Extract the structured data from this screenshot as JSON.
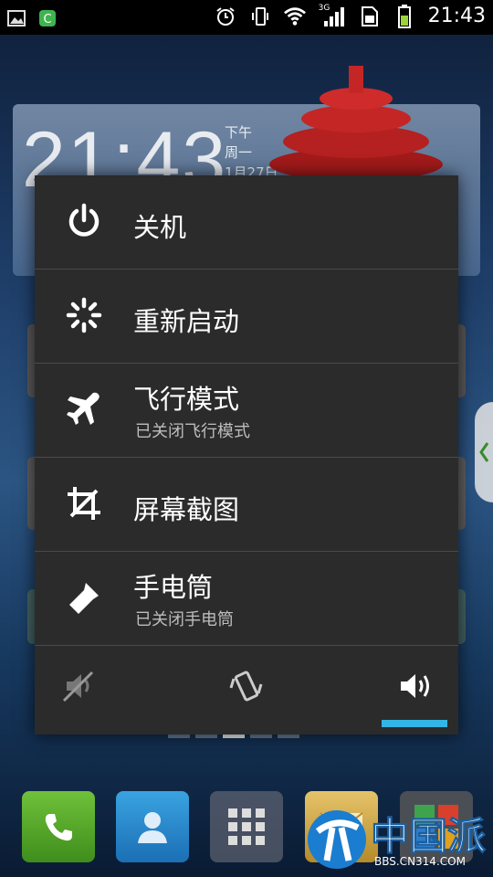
{
  "status_bar": {
    "time": "21:43",
    "network_type": "3G",
    "icons": [
      "gallery-icon",
      "security-shield-icon",
      "alarm-icon",
      "vibrate-icon",
      "wifi-icon",
      "signal-icon",
      "sim-icon",
      "battery-icon"
    ]
  },
  "clock_widget": {
    "time": "21:43",
    "ampm": "下午",
    "weekday": "周一",
    "date": "1月27日"
  },
  "power_menu": {
    "items": [
      {
        "label": "关机",
        "sub": "",
        "icon": "power-icon"
      },
      {
        "label": "重新启动",
        "sub": "",
        "icon": "restart-icon"
      },
      {
        "label": "飞行模式",
        "sub": "已关闭飞行模式",
        "icon": "airplane-icon"
      },
      {
        "label": "屏幕截图",
        "sub": "",
        "icon": "screenshot-crop-icon"
      },
      {
        "label": "手电筒",
        "sub": "已关闭手电筒",
        "icon": "flashlight-icon"
      }
    ],
    "sound_modes": [
      "mute",
      "vibrate",
      "sound"
    ],
    "selected_sound_mode": "sound",
    "accent_color": "#33b5e5"
  },
  "watermark": {
    "title": "中国派",
    "url": "BBS.CN314.COM"
  },
  "dock": {
    "icons": [
      "phone-icon",
      "contacts-icon",
      "app-drawer-icon",
      "messaging-icon",
      "apps-folder-icon"
    ]
  }
}
